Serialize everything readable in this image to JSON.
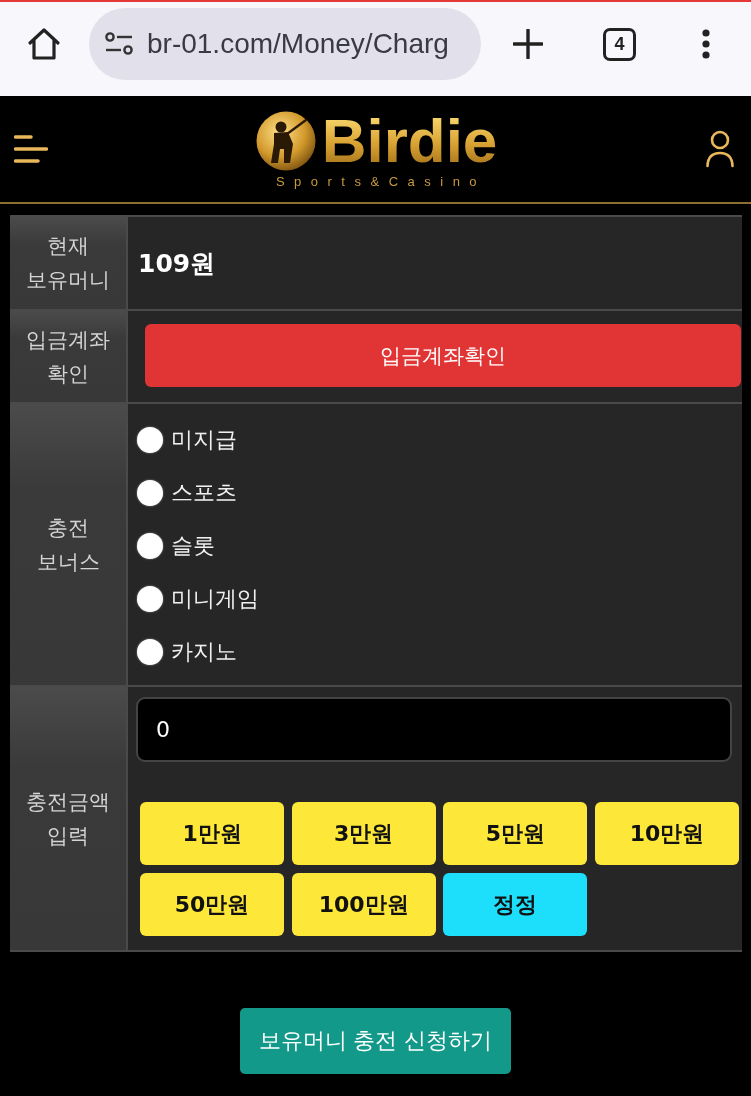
{
  "browser": {
    "url": "br-01.com/Money/Charg",
    "tab_count": "4"
  },
  "header": {
    "logo_title": "Birdie",
    "logo_subtitle": "Sports&Casino"
  },
  "form": {
    "rows": [
      {
        "kind": "balance",
        "label": "현재\n보유머니",
        "value": "109원"
      },
      {
        "kind": "button",
        "label": "입금계좌\n확인",
        "button": "입금계좌확인"
      },
      {
        "kind": "radios",
        "label": "충전\n보너스",
        "options": [
          {
            "label": "미지급",
            "selected": false
          },
          {
            "label": "스포츠",
            "selected": false
          },
          {
            "label": "슬롯",
            "selected": false
          },
          {
            "label": "미니게임",
            "selected": false
          },
          {
            "label": "카지노",
            "selected": false
          }
        ]
      },
      {
        "kind": "amount",
        "label": "충전금액\n입력",
        "value": "0",
        "buttons": [
          {
            "label": "1만원",
            "kind": "preset"
          },
          {
            "label": "3만원",
            "kind": "preset"
          },
          {
            "label": "5만원",
            "kind": "preset"
          },
          {
            "label": "10만원",
            "kind": "preset"
          },
          {
            "label": "50만원",
            "kind": "preset"
          },
          {
            "label": "100만원",
            "kind": "preset"
          },
          {
            "label": "정정",
            "kind": "reset"
          }
        ]
      }
    ]
  },
  "submit": {
    "label": "보유머니 충전 신청하기"
  }
}
